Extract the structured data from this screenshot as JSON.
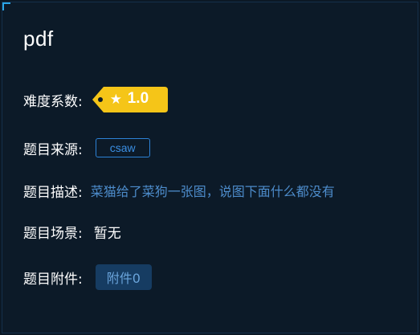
{
  "challenge": {
    "title": "pdf",
    "difficulty_label": "难度系数:",
    "difficulty_value": "1.0",
    "difficulty_icon": "star-icon",
    "difficulty_color": "#f5c518",
    "source_label": "题目来源:",
    "source_value": "csaw",
    "description_label": "题目描述:",
    "description_value": "菜猫给了菜狗一张图，说图下面什么都没有",
    "scene_label": "题目场景:",
    "scene_value": "暂无",
    "attachment_label": "题目附件:",
    "attachment_button": "附件0"
  },
  "colors": {
    "background": "#0c1a28",
    "accent": "#2aa6e8",
    "link": "#4d8ccb",
    "button_bg": "#163c62"
  }
}
